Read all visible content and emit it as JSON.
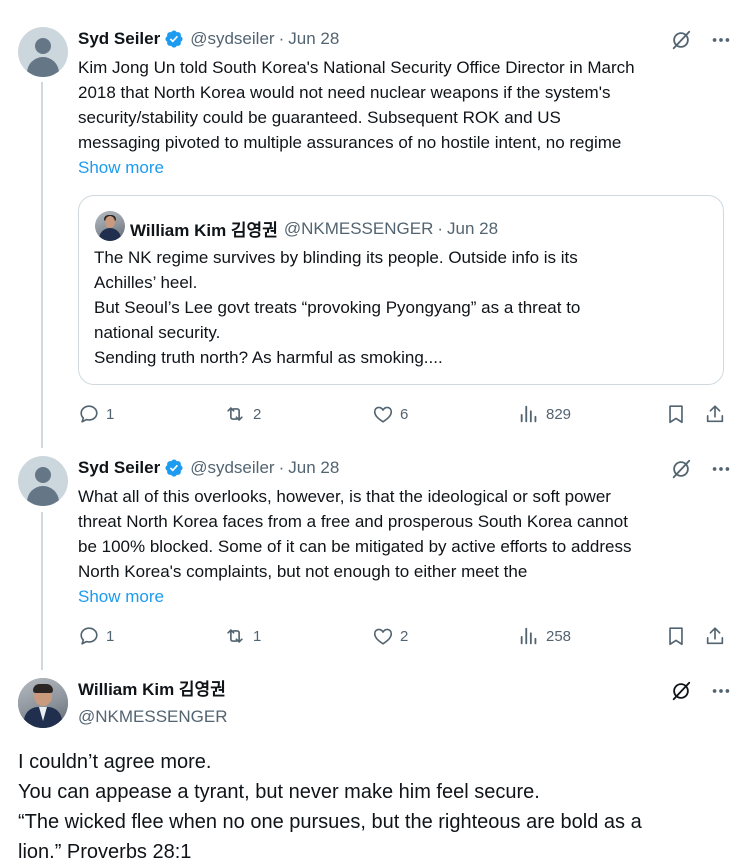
{
  "tweets": [
    {
      "author": "Syd Seiler",
      "handle": "@sydseiler",
      "date": "Jun 28",
      "lines": [
        "Kim Jong Un told South Korea's National Security Office Director in March",
        "2018 that North Korea would not need nuclear weapons if the system's",
        "security/stability could be guaranteed.  Subsequent ROK and US",
        "messaging pivoted to multiple assurances of no hostile intent, no regime"
      ],
      "show_more": "Show more",
      "quote": {
        "author": "William Kim 김영권",
        "handle": "@NKMESSENGER",
        "date": "Jun 28",
        "lines": [
          "The NK regime survives by blinding its people. Outside info is its",
          "Achilles’ heel.",
          "But Seoul’s Lee govt treats “provoking Pyongyang” as a threat to",
          "national security.",
          "Sending truth north? As harmful as smoking...."
        ]
      },
      "replies": "1",
      "retweets": "2",
      "likes": "6",
      "views": "829"
    },
    {
      "author": "Syd Seiler",
      "handle": "@sydseiler",
      "date": "Jun 28",
      "lines": [
        "What all of this overlooks, however, is that the ideological or soft power",
        "threat North Korea faces from a free and prosperous South Korea cannot",
        "be 100% blocked.  Some of it can be mitigated by active efforts to address",
        "North Korea's complaints, but not enough to either meet the"
      ],
      "show_more": "Show more",
      "replies": "1",
      "retweets": "1",
      "likes": "2",
      "views": "258"
    }
  ],
  "main_tweet": {
    "author": "William Kim 김영권",
    "handle": "@NKMESSENGER",
    "lines": [
      "I couldn’t agree more.",
      "You can appease a tyrant, but never make him feel secure.",
      "“The wicked flee when no one pursues, but the righteous are bold as a",
      "lion.” Proverbs 28:1"
    ]
  },
  "dot_separator": "·",
  "colors": {
    "accent": "#1d9bf0",
    "text": "#0f1419",
    "secondary": "#536471",
    "border": "#cfd9de"
  },
  "icons": {
    "verified": "verified-badge-icon",
    "grok": "grok-icon",
    "more": "more-icon",
    "reply": "reply-icon",
    "retweet": "retweet-icon",
    "like": "like-icon",
    "views": "views-icon",
    "bookmark": "bookmark-icon",
    "share": "share-icon"
  }
}
